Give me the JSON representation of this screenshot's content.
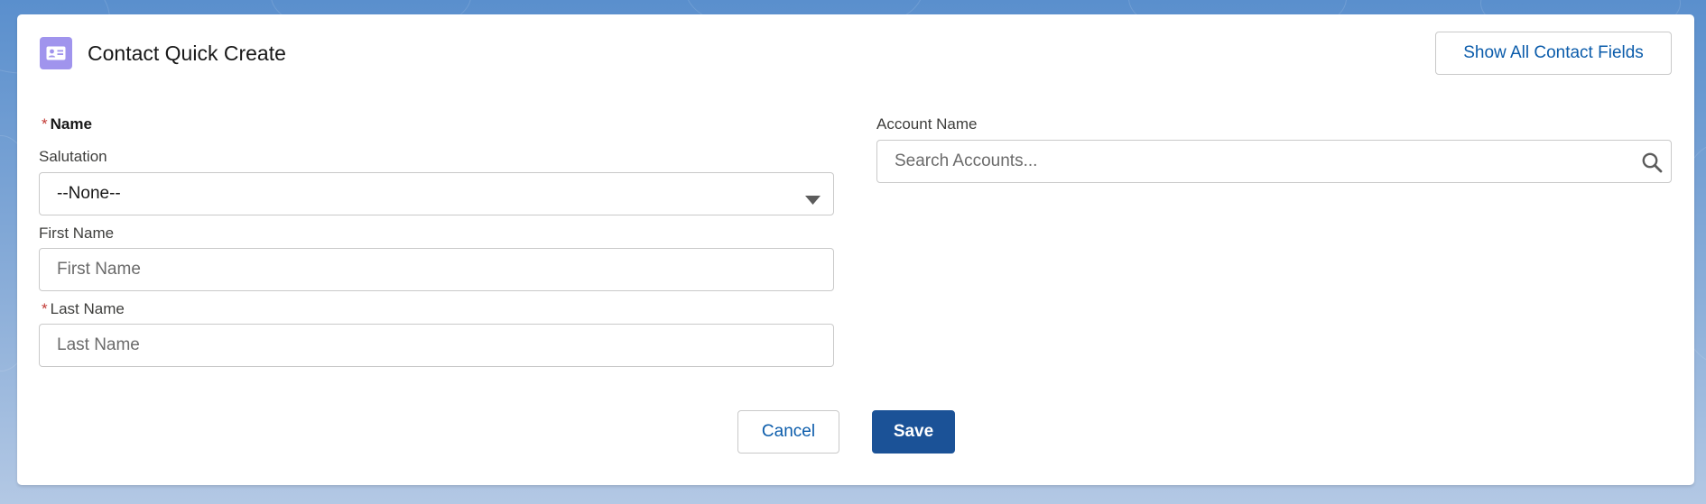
{
  "modal": {
    "title": "Contact Quick Create",
    "icon": "contact-card-icon",
    "accent_color": "#a094ed",
    "show_all_fields_label": "Show All Contact Fields"
  },
  "form": {
    "required_marker": "*",
    "name_section_label": "Name",
    "salutation": {
      "label": "Salutation",
      "value": "--None--",
      "icon": "caret-down-icon"
    },
    "first_name": {
      "label": "First Name",
      "value": "",
      "placeholder": "First Name"
    },
    "last_name": {
      "label": "Last Name",
      "value": "",
      "placeholder": "Last Name"
    },
    "account_name": {
      "label": "Account Name",
      "value": "",
      "placeholder": "Search Accounts...",
      "icon": "search-icon"
    }
  },
  "footer": {
    "cancel_label": "Cancel",
    "save_label": "Save",
    "brand_color": "#1b5297"
  }
}
